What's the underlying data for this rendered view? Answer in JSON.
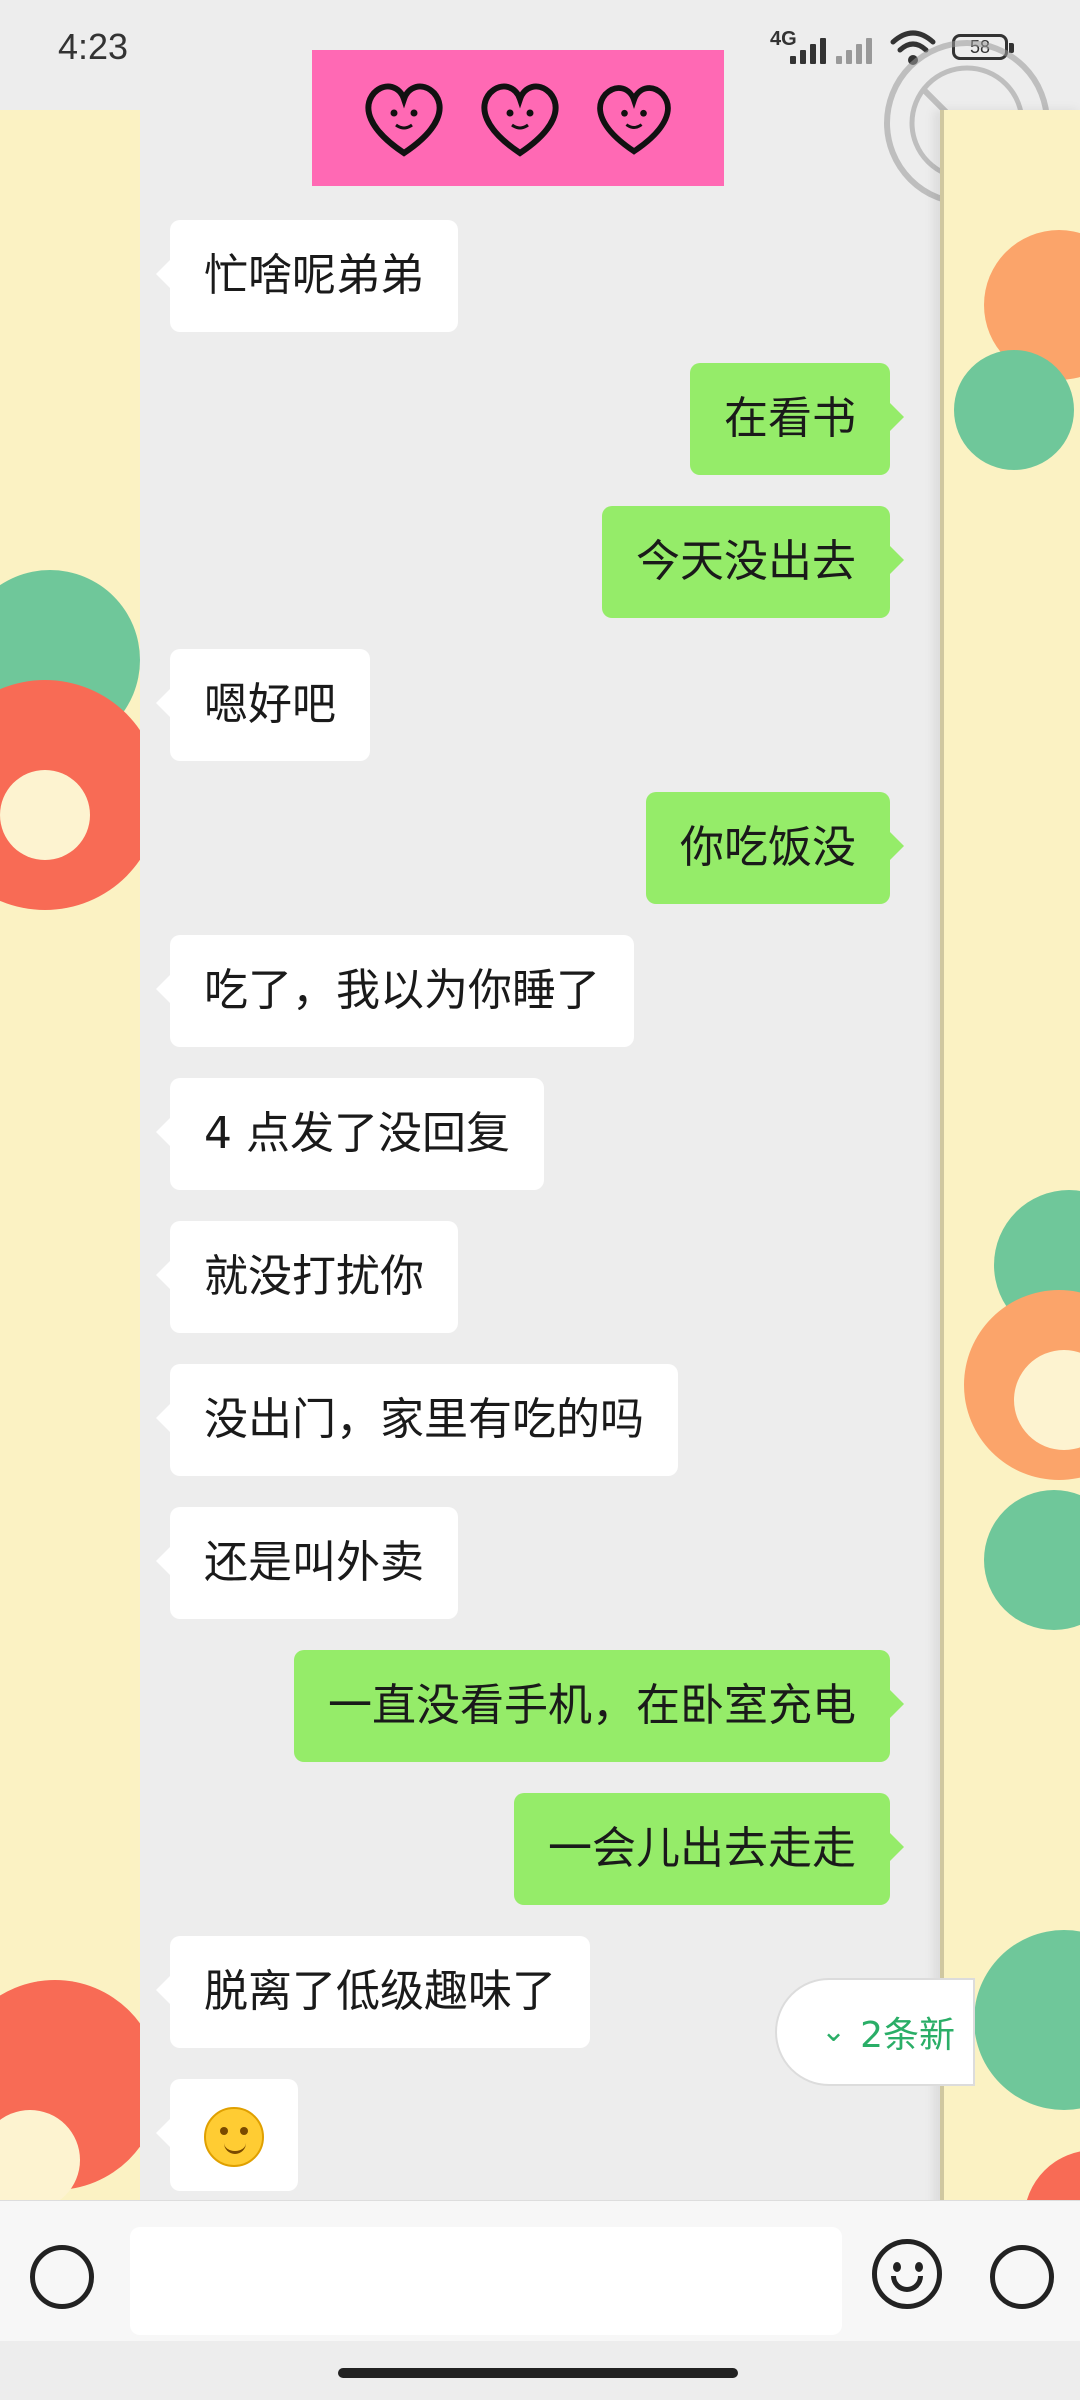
{
  "status_bar": {
    "time": "4:23",
    "network": "4G",
    "battery": "58"
  },
  "chat": {
    "messages": [
      {
        "side": "in",
        "text": "忙啥呢弟弟"
      },
      {
        "side": "out",
        "text": "在看书"
      },
      {
        "side": "out",
        "text": "今天没出去"
      },
      {
        "side": "in",
        "text": "嗯好吧"
      },
      {
        "side": "out",
        "text": "你吃饭没"
      },
      {
        "side": "in",
        "text": "吃了，我以为你睡了"
      },
      {
        "side": "in",
        "text": "4 点发了没回复"
      },
      {
        "side": "in",
        "text": "就没打扰你"
      },
      {
        "side": "in",
        "text": "没出门，家里有吃的吗"
      },
      {
        "side": "in",
        "text": "还是叫外卖"
      },
      {
        "side": "out",
        "text": "一直没看手机，在卧室充电"
      },
      {
        "side": "out",
        "text": "一会儿出去走走"
      },
      {
        "side": "in",
        "text": "脱离了低级趣味了"
      },
      {
        "side": "in",
        "text": "",
        "emoji": "thinking-face"
      }
    ],
    "new_messages_label": "2条新"
  },
  "input": {
    "value": "",
    "placeholder": ""
  },
  "colors": {
    "chat_bg": "#ededed",
    "outgoing_bubble": "#95ec69",
    "incoming_bubble": "#ffffff",
    "sticker_bg": "#ff69b4",
    "new_pill_text": "#2aae67",
    "side_panel_bg": "#fbf2c3"
  }
}
